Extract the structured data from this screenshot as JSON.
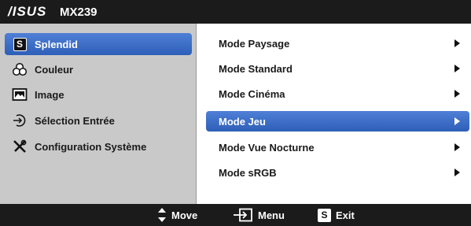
{
  "header": {
    "brand": "/ISUS",
    "model": "MX239"
  },
  "main_menu": {
    "items": [
      {
        "label": "Splendid",
        "icon": "splendid-icon",
        "selected": true
      },
      {
        "label": "Couleur",
        "icon": "color-icon",
        "selected": false
      },
      {
        "label": "Image",
        "icon": "image-icon",
        "selected": false
      },
      {
        "label": "Sélection Entrée",
        "icon": "input-select-icon",
        "selected": false
      },
      {
        "label": "Configuration Système",
        "icon": "tools-icon",
        "selected": false
      }
    ]
  },
  "submenu": {
    "items": [
      {
        "label": "Mode Paysage",
        "selected": false
      },
      {
        "label": "Mode Standard",
        "selected": false
      },
      {
        "label": "Mode Cinéma",
        "selected": false
      },
      {
        "label": "Mode Jeu",
        "selected": true
      },
      {
        "label": "Mode Vue Nocturne",
        "selected": false
      },
      {
        "label": "Mode sRGB",
        "selected": false
      }
    ]
  },
  "footer": {
    "move_label": "Move",
    "menu_label": "Menu",
    "exit_label": "Exit",
    "exit_icon_letter": "S"
  },
  "colors": {
    "highlight": "#3a6cc8",
    "panel": "#c9c9c9",
    "bar": "#1b1b1b"
  }
}
